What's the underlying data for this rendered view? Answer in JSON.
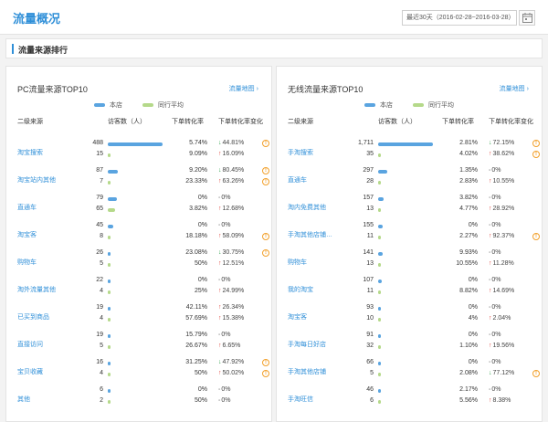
{
  "header": {
    "title": "流量概况",
    "date_range": "最近30天（2016-02-28~2016-03-28）",
    "calendar_icon": "calendar-icon"
  },
  "section": {
    "title": "流量来源排行"
  },
  "colors": {
    "accent": "#2f8fd8",
    "store_bar": "#5aa4e0",
    "peer_bar": "#b5d98a",
    "up": "#e14b44",
    "down": "#3aa655",
    "warn": "#f2a02b"
  },
  "panels": [
    {
      "title": "PC流量来源TOP10",
      "link": "流量地图",
      "legend": {
        "store": "本店",
        "peer": "同行平均"
      },
      "headers": {
        "name": "二级来源",
        "visits": "访客数（人）",
        "rate": "下单转化率",
        "change": "下单转化率变化"
      },
      "rows": [
        {
          "name": "淘宝搜索",
          "store": {
            "visits": 488,
            "rate": "5.74%",
            "dir": "down",
            "change": "44.81%",
            "warn": true
          },
          "peer": {
            "visits": 15,
            "rate": "9.09%",
            "dir": "up",
            "change": "16.09%",
            "warn": false
          }
        },
        {
          "name": "淘宝站内其他",
          "store": {
            "visits": 87,
            "rate": "9.20%",
            "dir": "down",
            "change": "80.45%",
            "warn": true
          },
          "peer": {
            "visits": 7,
            "rate": "23.33%",
            "dir": "up",
            "change": "63.26%",
            "warn": true
          }
        },
        {
          "name": "直通车",
          "store": {
            "visits": 79,
            "rate": "0%",
            "dir": "flat",
            "change": "0%",
            "warn": false
          },
          "peer": {
            "visits": 65,
            "rate": "3.82%",
            "dir": "up",
            "change": "12.68%",
            "warn": false
          }
        },
        {
          "name": "淘宝客",
          "store": {
            "visits": 45,
            "rate": "0%",
            "dir": "flat",
            "change": "0%",
            "warn": false
          },
          "peer": {
            "visits": 8,
            "rate": "18.18%",
            "dir": "up",
            "change": "58.09%",
            "warn": true
          }
        },
        {
          "name": "购物车",
          "store": {
            "visits": 26,
            "rate": "23.08%",
            "dir": "down",
            "change": "30.75%",
            "warn": true
          },
          "peer": {
            "visits": 5,
            "rate": "50%",
            "dir": "up",
            "change": "12.51%",
            "warn": false
          }
        },
        {
          "name": "淘外流量其他",
          "store": {
            "visits": 22,
            "rate": "0%",
            "dir": "flat",
            "change": "0%",
            "warn": false
          },
          "peer": {
            "visits": 4,
            "rate": "25%",
            "dir": "up",
            "change": "24.99%",
            "warn": false
          }
        },
        {
          "name": "已买到商品",
          "store": {
            "visits": 19,
            "rate": "42.11%",
            "dir": "up",
            "change": "26.34%",
            "warn": false
          },
          "peer": {
            "visits": 4,
            "rate": "57.69%",
            "dir": "up",
            "change": "15.38%",
            "warn": false
          }
        },
        {
          "name": "直接访问",
          "store": {
            "visits": 19,
            "rate": "15.79%",
            "dir": "flat",
            "change": "0%",
            "warn": false
          },
          "peer": {
            "visits": 5,
            "rate": "26.67%",
            "dir": "up",
            "change": "6.65%",
            "warn": false
          }
        },
        {
          "name": "宝贝收藏",
          "store": {
            "visits": 16,
            "rate": "31.25%",
            "dir": "down",
            "change": "47.92%",
            "warn": true
          },
          "peer": {
            "visits": 4,
            "rate": "50%",
            "dir": "up",
            "change": "50.02%",
            "warn": true
          }
        },
        {
          "name": "其他",
          "store": {
            "visits": 6,
            "rate": "0%",
            "dir": "flat",
            "change": "0%",
            "warn": false
          },
          "peer": {
            "visits": 2,
            "rate": "50%",
            "dir": "flat",
            "change": "0%",
            "warn": false
          }
        }
      ]
    },
    {
      "title": "无线流量来源TOP10",
      "link": "流量地图",
      "legend": {
        "store": "本店",
        "peer": "同行平均"
      },
      "headers": {
        "name": "二级来源",
        "visits": "访客数（人）",
        "rate": "下单转化率",
        "change": "下单转化率变化"
      },
      "rows": [
        {
          "name": "手淘搜索",
          "store": {
            "visits": 1711,
            "rate": "2.81%",
            "dir": "down",
            "change": "72.15%",
            "warn": true
          },
          "peer": {
            "visits": 35,
            "rate": "4.02%",
            "dir": "up",
            "change": "38.62%",
            "warn": true
          }
        },
        {
          "name": "直通车",
          "store": {
            "visits": 297,
            "rate": "1.35%",
            "dir": "flat",
            "change": "0%",
            "warn": false
          },
          "peer": {
            "visits": 28,
            "rate": "2.83%",
            "dir": "up",
            "change": "10.55%",
            "warn": false
          }
        },
        {
          "name": "淘内免费其他",
          "store": {
            "visits": 157,
            "rate": "3.82%",
            "dir": "flat",
            "change": "0%",
            "warn": false
          },
          "peer": {
            "visits": 13,
            "rate": "4.77%",
            "dir": "up",
            "change": "28.92%",
            "warn": false
          }
        },
        {
          "name": "手淘其他店铺…",
          "store": {
            "visits": 155,
            "rate": "0%",
            "dir": "flat",
            "change": "0%",
            "warn": false
          },
          "peer": {
            "visits": 11,
            "rate": "2.27%",
            "dir": "up",
            "change": "92.37%",
            "warn": true
          }
        },
        {
          "name": "购物车",
          "store": {
            "visits": 141,
            "rate": "9.93%",
            "dir": "flat",
            "change": "0%",
            "warn": false
          },
          "peer": {
            "visits": 13,
            "rate": "10.55%",
            "dir": "up",
            "change": "11.28%",
            "warn": false
          }
        },
        {
          "name": "我的淘宝",
          "store": {
            "visits": 107,
            "rate": "0%",
            "dir": "flat",
            "change": "0%",
            "warn": false
          },
          "peer": {
            "visits": 11,
            "rate": "8.82%",
            "dir": "up",
            "change": "14.69%",
            "warn": false
          }
        },
        {
          "name": "淘宝客",
          "store": {
            "visits": 93,
            "rate": "0%",
            "dir": "flat",
            "change": "0%",
            "warn": false
          },
          "peer": {
            "visits": 10,
            "rate": "4%",
            "dir": "up",
            "change": "2.04%",
            "warn": false
          }
        },
        {
          "name": "手淘每日好店",
          "store": {
            "visits": 91,
            "rate": "0%",
            "dir": "flat",
            "change": "0%",
            "warn": false
          },
          "peer": {
            "visits": 32,
            "rate": "1.10%",
            "dir": "up",
            "change": "19.56%",
            "warn": false
          }
        },
        {
          "name": "手淘其他店铺",
          "store": {
            "visits": 66,
            "rate": "0%",
            "dir": "flat",
            "change": "0%",
            "warn": false
          },
          "peer": {
            "visits": 5,
            "rate": "2.08%",
            "dir": "down",
            "change": "77.12%",
            "warn": true
          }
        },
        {
          "name": "手淘旺信",
          "store": {
            "visits": 46,
            "rate": "2.17%",
            "dir": "flat",
            "change": "0%",
            "warn": false
          },
          "peer": {
            "visits": 6,
            "rate": "5.56%",
            "dir": "up",
            "change": "8.38%",
            "warn": false
          }
        }
      ]
    }
  ]
}
